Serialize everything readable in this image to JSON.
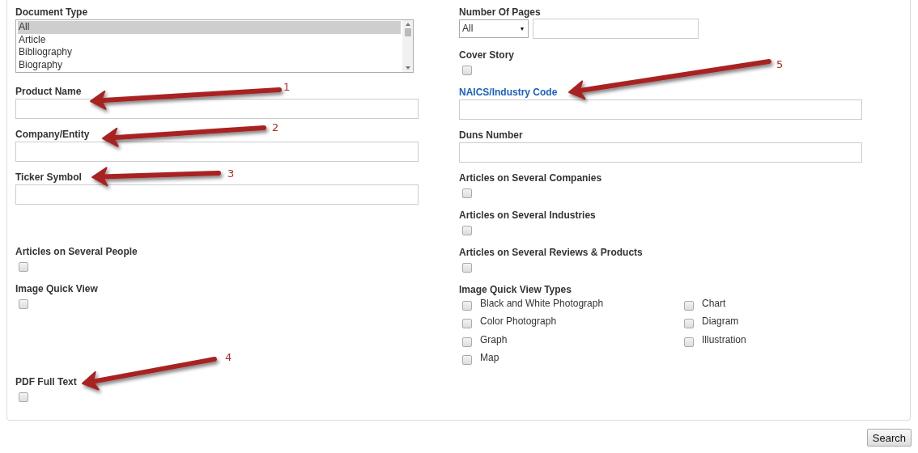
{
  "left_fields": [
    {
      "kind": "listbox",
      "label": "Document Type",
      "options": [
        {
          "label": "All",
          "selected": true
        },
        {
          "label": "Article",
          "selected": false
        },
        {
          "label": "Bibliography",
          "selected": false
        },
        {
          "label": "Biography",
          "selected": false
        }
      ]
    },
    {
      "kind": "text",
      "label": "Product Name"
    },
    {
      "kind": "text",
      "label": "Company/Entity"
    },
    {
      "kind": "text",
      "label": "Ticker Symbol"
    },
    {
      "kind": "checkbox",
      "label": "Articles on Several People",
      "checked": false
    },
    {
      "kind": "checkbox",
      "label": "Image Quick View",
      "checked": false
    },
    {
      "kind": "checkbox",
      "label": "PDF Full Text",
      "checked": false
    }
  ],
  "right_fields": [
    {
      "kind": "pages",
      "label": "Number Of Pages",
      "select_value": "All"
    },
    {
      "kind": "checkbox",
      "label": "Cover Story",
      "checked": false
    },
    {
      "kind": "link_text",
      "label": "NAICS/Industry Code"
    },
    {
      "kind": "text",
      "label": "Duns Number"
    },
    {
      "kind": "checkbox",
      "label": "Articles on Several Companies",
      "checked": false
    },
    {
      "kind": "checkbox",
      "label": "Articles on Several Industries",
      "checked": false
    },
    {
      "kind": "checkbox",
      "label": "Articles on Several Reviews & Products",
      "checked": false
    },
    {
      "kind": "checkgroup",
      "label": "Image Quick View Types",
      "options": [
        {
          "label": "Black and White Photograph",
          "checked": false
        },
        {
          "label": "Color Photograph",
          "checked": false
        },
        {
          "label": "Graph",
          "checked": false
        },
        {
          "label": "Map",
          "checked": false
        },
        {
          "label": "Chart",
          "checked": false
        },
        {
          "label": "Diagram",
          "checked": false
        },
        {
          "label": "Illustration",
          "checked": false
        }
      ]
    }
  ],
  "search_button": "Search",
  "annotations": [
    {
      "number": "1"
    },
    {
      "number": "2"
    },
    {
      "number": "3"
    },
    {
      "number": "4"
    },
    {
      "number": "5"
    }
  ]
}
